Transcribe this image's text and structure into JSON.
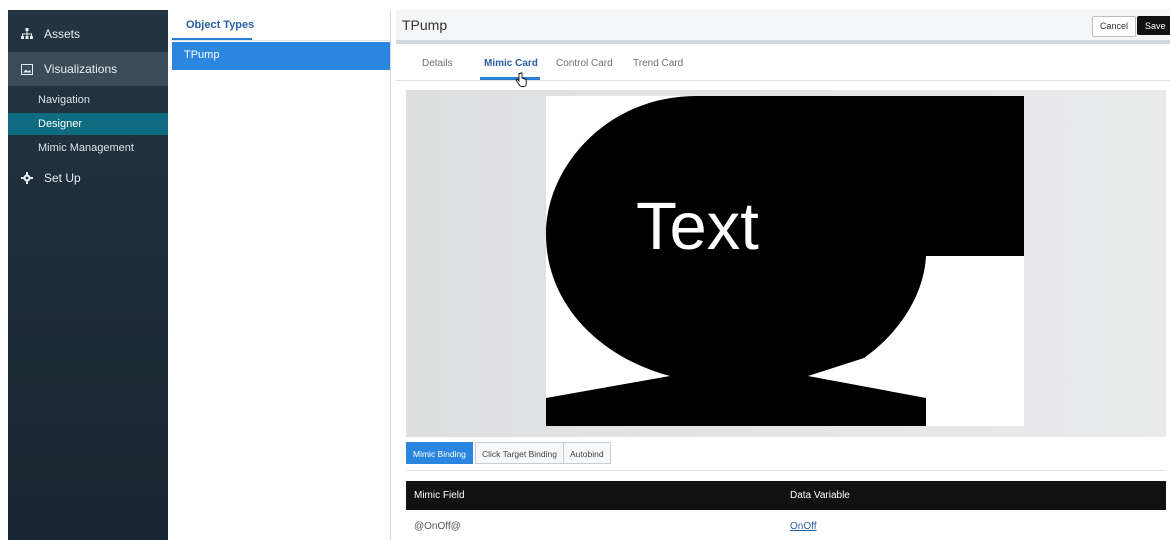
{
  "sidebar": {
    "assets": {
      "label": "Assets",
      "icon": "sitemap-icon"
    },
    "visualizations": {
      "label": "Visualizations",
      "icon": "image-icon"
    },
    "sub_items": [
      {
        "label": "Navigation"
      },
      {
        "label": "Designer"
      },
      {
        "label": "Mimic Management"
      }
    ],
    "setup": {
      "label": "Set Up",
      "icon": "gear-icon"
    }
  },
  "object_types": {
    "tab_label": "Object Types",
    "items": [
      {
        "label": "TPump"
      }
    ]
  },
  "header": {
    "title": "TPump",
    "cancel_label": "Cancel",
    "save_label": "Save"
  },
  "tabs": [
    {
      "label": "Details"
    },
    {
      "label": "Mimic Card"
    },
    {
      "label": "Control Card"
    },
    {
      "label": "Trend Card"
    }
  ],
  "canvas": {
    "text": "Text"
  },
  "binding_tabs": [
    {
      "label": "Mimic Binding"
    },
    {
      "label": "Click Target Binding"
    },
    {
      "label": "Autobind"
    }
  ],
  "table": {
    "headers": [
      "Mimic Field",
      "Data Variable"
    ],
    "rows": [
      {
        "field": "@OnOff@",
        "variable": "OnOff"
      }
    ]
  },
  "colors": {
    "sidebar_bg": "#1d2b36",
    "sidebar_active": "#0f6b80",
    "accent": "#2b86e0"
  }
}
